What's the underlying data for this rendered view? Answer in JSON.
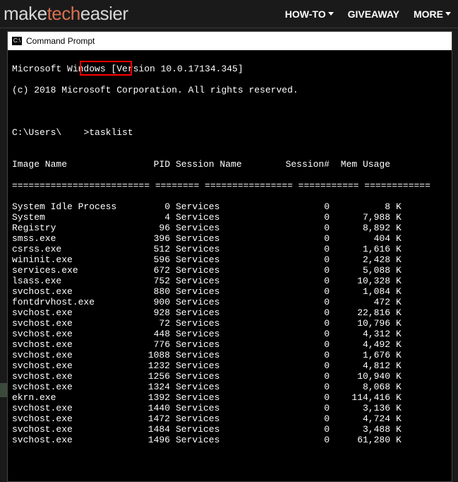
{
  "site": {
    "logo_make": "make",
    "logo_tech": "tech",
    "logo_easier": "easier",
    "nav_howto": "HOW-TO",
    "nav_giveaway": "GIVEAWAY",
    "nav_more": "MORE"
  },
  "window": {
    "title": "Command Prompt",
    "icon_glyph": "C:\\"
  },
  "terminal": {
    "banner_line1": "Microsoft Windows [Version 10.0.17134.345]",
    "banner_line2": "(c) 2018 Microsoft Corporation. All rights reserved.",
    "prompt_path": "C:\\Users\\",
    "prompt_arrow": ">",
    "command": "tasklist",
    "columns": {
      "image_name": "Image Name",
      "pid": "PID",
      "session_name": "Session Name",
      "session_num": "Session#",
      "mem_usage": "Mem Usage"
    },
    "processes": [
      {
        "name": "System Idle Process",
        "pid": "0",
        "session": "Services",
        "snum": "0",
        "mem": "8"
      },
      {
        "name": "System",
        "pid": "4",
        "session": "Services",
        "snum": "0",
        "mem": "7,988"
      },
      {
        "name": "Registry",
        "pid": "96",
        "session": "Services",
        "snum": "0",
        "mem": "8,892"
      },
      {
        "name": "smss.exe",
        "pid": "396",
        "session": "Services",
        "snum": "0",
        "mem": "404"
      },
      {
        "name": "csrss.exe",
        "pid": "512",
        "session": "Services",
        "snum": "0",
        "mem": "1,616"
      },
      {
        "name": "wininit.exe",
        "pid": "596",
        "session": "Services",
        "snum": "0",
        "mem": "2,428"
      },
      {
        "name": "services.exe",
        "pid": "672",
        "session": "Services",
        "snum": "0",
        "mem": "5,088"
      },
      {
        "name": "lsass.exe",
        "pid": "752",
        "session": "Services",
        "snum": "0",
        "mem": "10,328"
      },
      {
        "name": "svchost.exe",
        "pid": "880",
        "session": "Services",
        "snum": "0",
        "mem": "1,084"
      },
      {
        "name": "fontdrvhost.exe",
        "pid": "900",
        "session": "Services",
        "snum": "0",
        "mem": "472"
      },
      {
        "name": "svchost.exe",
        "pid": "928",
        "session": "Services",
        "snum": "0",
        "mem": "22,816"
      },
      {
        "name": "svchost.exe",
        "pid": "72",
        "session": "Services",
        "snum": "0",
        "mem": "10,796"
      },
      {
        "name": "svchost.exe",
        "pid": "448",
        "session": "Services",
        "snum": "0",
        "mem": "4,312"
      },
      {
        "name": "svchost.exe",
        "pid": "776",
        "session": "Services",
        "snum": "0",
        "mem": "4,492"
      },
      {
        "name": "svchost.exe",
        "pid": "1088",
        "session": "Services",
        "snum": "0",
        "mem": "1,676"
      },
      {
        "name": "svchost.exe",
        "pid": "1232",
        "session": "Services",
        "snum": "0",
        "mem": "4,812"
      },
      {
        "name": "svchost.exe",
        "pid": "1256",
        "session": "Services",
        "snum": "0",
        "mem": "10,940"
      },
      {
        "name": "svchost.exe",
        "pid": "1324",
        "session": "Services",
        "snum": "0",
        "mem": "8,068"
      },
      {
        "name": "ekrn.exe",
        "pid": "1392",
        "session": "Services",
        "snum": "0",
        "mem": "114,416"
      },
      {
        "name": "svchost.exe",
        "pid": "1440",
        "session": "Services",
        "snum": "0",
        "mem": "3,136"
      },
      {
        "name": "svchost.exe",
        "pid": "1472",
        "session": "Services",
        "snum": "0",
        "mem": "4,724"
      },
      {
        "name": "svchost.exe",
        "pid": "1484",
        "session": "Services",
        "snum": "0",
        "mem": "3,488"
      },
      {
        "name": "svchost.exe",
        "pid": "1496",
        "session": "Services",
        "snum": "0",
        "mem": "61,280"
      }
    ],
    "mem_unit": "K"
  }
}
